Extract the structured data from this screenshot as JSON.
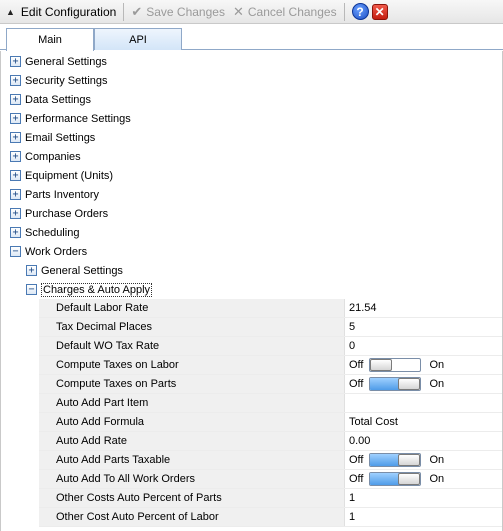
{
  "toolbar": {
    "title": "Edit Configuration",
    "save_label": "Save Changes",
    "cancel_label": "Cancel Changes",
    "help_glyph": "?",
    "close_glyph": "✕"
  },
  "tabs": [
    {
      "label": "Main",
      "active": true
    },
    {
      "label": "API",
      "active": false
    }
  ],
  "tree": {
    "groups": [
      {
        "label": "General Settings",
        "expanded": false
      },
      {
        "label": "Security Settings",
        "expanded": false
      },
      {
        "label": "Data Settings",
        "expanded": false
      },
      {
        "label": "Performance Settings",
        "expanded": false
      },
      {
        "label": "Email Settings",
        "expanded": false
      },
      {
        "label": "Companies",
        "expanded": false
      },
      {
        "label": "Equipment (Units)",
        "expanded": false
      },
      {
        "label": "Parts Inventory",
        "expanded": false
      },
      {
        "label": "Purchase Orders",
        "expanded": false
      },
      {
        "label": "Scheduling",
        "expanded": false
      },
      {
        "label": "Work Orders",
        "expanded": true
      }
    ],
    "work_orders": {
      "subgroups": [
        {
          "label": "General Settings",
          "expanded": false
        },
        {
          "label": "Charges & Auto Apply",
          "expanded": true
        }
      ]
    },
    "properties": [
      {
        "name": "Default Labor Rate",
        "value": "21.54"
      },
      {
        "name": "Tax Decimal Places",
        "value": "5"
      },
      {
        "name": "Default WO Tax Rate",
        "value": "0"
      },
      {
        "name": "Compute Taxes on Labor",
        "toggle": true,
        "off_label": "Off",
        "on_label": "On",
        "state": "off"
      },
      {
        "name": "Compute Taxes on Parts",
        "toggle": true,
        "off_label": "Off",
        "on_label": "On",
        "state": "on"
      },
      {
        "name": "Auto Add Part Item",
        "value": ""
      },
      {
        "name": "Auto Add Formula",
        "value": "Total Cost"
      },
      {
        "name": "Auto Add Rate",
        "value": "0.00"
      },
      {
        "name": "Auto Add Parts Taxable",
        "toggle": true,
        "off_label": "Off",
        "on_label": "On",
        "state": "on"
      },
      {
        "name": "Auto Add To All Work Orders",
        "toggle": true,
        "off_label": "Off",
        "on_label": "On",
        "state": "on"
      },
      {
        "name": "Other Costs Auto Percent of Parts",
        "value": "1"
      },
      {
        "name": "Other Cost Auto Percent of Labor",
        "value": "1"
      }
    ]
  },
  "colors": {
    "accent": "#4f9ce8",
    "tab_border": "#8fa8c8",
    "property_name_bg": "#f0f0f0"
  }
}
